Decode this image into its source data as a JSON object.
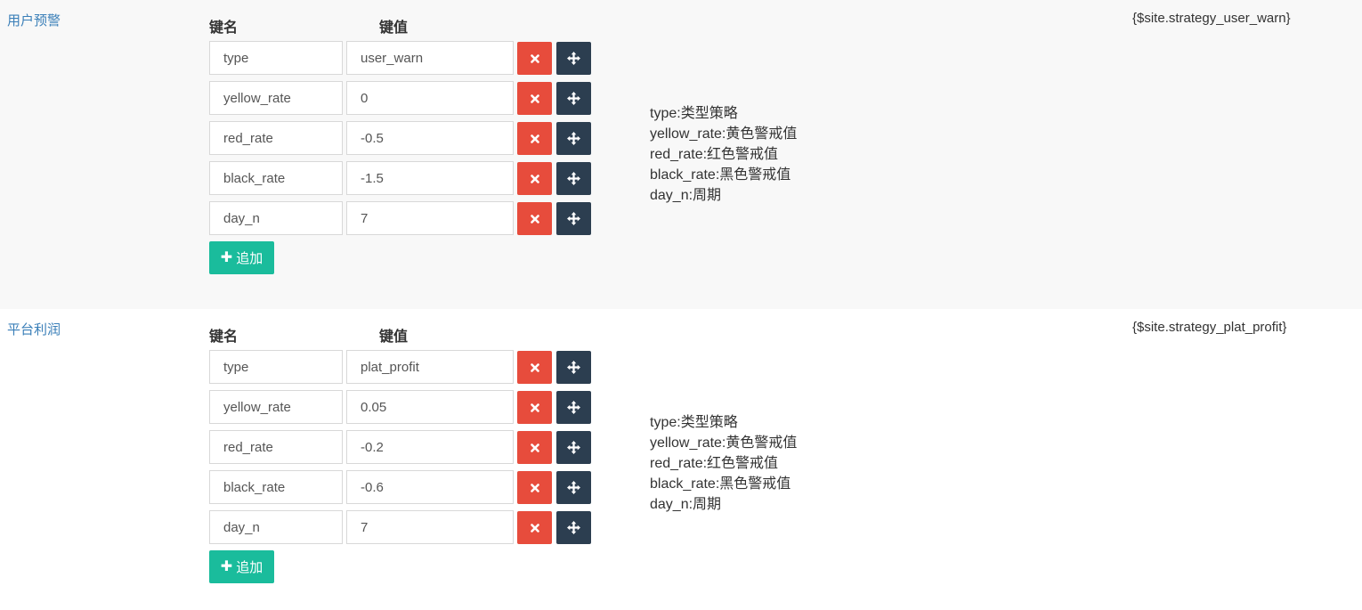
{
  "columns": {
    "key_header": "键名",
    "value_header": "键值"
  },
  "add_label": "追加",
  "sections": [
    {
      "title": "用户预警",
      "variable": "{$site.strategy_user_warn}",
      "rows": [
        {
          "key": "type",
          "value": "user_warn"
        },
        {
          "key": "yellow_rate",
          "value": "0"
        },
        {
          "key": "red_rate",
          "value": "-0.5"
        },
        {
          "key": "black_rate",
          "value": "-1.5"
        },
        {
          "key": "day_n",
          "value": "7"
        }
      ],
      "help": [
        "type:类型策略",
        "yellow_rate:黄色警戒值",
        "red_rate:红色警戒值",
        "black_rate:黑色警戒值",
        "day_n:周期"
      ]
    },
    {
      "title": "平台利润",
      "variable": "{$site.strategy_plat_profit}",
      "rows": [
        {
          "key": "type",
          "value": "plat_profit"
        },
        {
          "key": "yellow_rate",
          "value": "0.05"
        },
        {
          "key": "red_rate",
          "value": "-0.2"
        },
        {
          "key": "black_rate",
          "value": "-0.6"
        },
        {
          "key": "day_n",
          "value": "7"
        }
      ],
      "help": [
        "type:类型策略",
        "yellow_rate:黄色警戒值",
        "red_rate:红色警戒值",
        "black_rate:黑色警戒值",
        "day_n:周期"
      ]
    }
  ],
  "icons": {
    "delete": "times-icon",
    "move": "arrows-move-icon",
    "add": "plus-icon"
  },
  "colors": {
    "delete": "#e74c3c",
    "move": "#2c3e50",
    "add": "#1abc9c",
    "link": "#3a7fb8"
  }
}
